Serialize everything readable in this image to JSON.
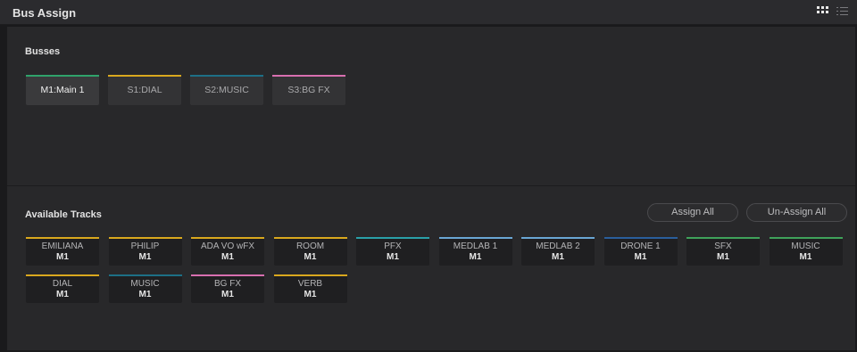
{
  "window": {
    "title": "Bus Assign"
  },
  "toolbar": {
    "grid_view_icon": "grid-view-icon",
    "list_view_icon": "list-view-icon"
  },
  "busses": {
    "heading": "Busses",
    "items": [
      {
        "label": "M1:Main 1",
        "color": "#2fa36b",
        "active": true
      },
      {
        "label": "S1:DIAL",
        "color": "#d9a81e",
        "active": false
      },
      {
        "label": "S2:MUSIC",
        "color": "#1d6f86",
        "active": false
      },
      {
        "label": "S3:BG FX",
        "color": "#d86fb0",
        "active": false
      }
    ]
  },
  "tracks": {
    "heading": "Available Tracks",
    "assign_all_label": "Assign All",
    "unassign_all_label": "Un-Assign All",
    "items": [
      {
        "name": "EMILIANA",
        "bus": "M1",
        "color": "#d9a81e"
      },
      {
        "name": "PHILIP",
        "bus": "M1",
        "color": "#d9a81e"
      },
      {
        "name": "ADA VO wFX",
        "bus": "M1",
        "color": "#d9a81e"
      },
      {
        "name": "ROOM",
        "bus": "M1",
        "color": "#d9a81e"
      },
      {
        "name": "PFX",
        "bus": "M1",
        "color": "#2aa0a8"
      },
      {
        "name": "MEDLAB 1",
        "bus": "M1",
        "color": "#6aa6d4"
      },
      {
        "name": "MEDLAB 2",
        "bus": "M1",
        "color": "#6aa6d4"
      },
      {
        "name": "DRONE 1",
        "bus": "M1",
        "color": "#2a5e9c"
      },
      {
        "name": "SFX",
        "bus": "M1",
        "color": "#3fa25a"
      },
      {
        "name": "MUSIC",
        "bus": "M1",
        "color": "#3fa25a"
      },
      {
        "name": "DIAL",
        "bus": "M1",
        "color": "#d9a81e"
      },
      {
        "name": "MUSIC",
        "bus": "M1",
        "color": "#1d6f86"
      },
      {
        "name": "BG FX",
        "bus": "M1",
        "color": "#d86fb0"
      },
      {
        "name": "VERB",
        "bus": "M1",
        "color": "#d9a81e"
      }
    ]
  }
}
